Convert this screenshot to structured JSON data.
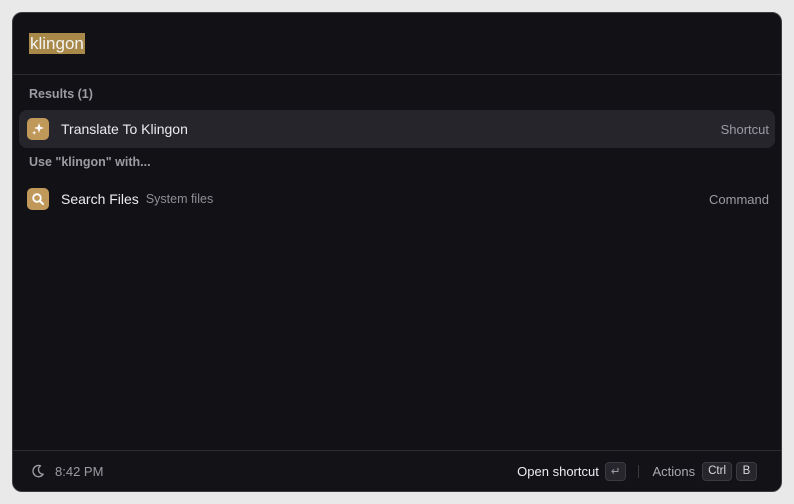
{
  "search": {
    "query": "klingon"
  },
  "sections": {
    "results_title": "Results (1)",
    "fallback_title": "Use \"klingon\" with..."
  },
  "items": [
    {
      "title": "Translate To Klingon",
      "subtitle": "",
      "accessory": "Shortcut",
      "icon": "sparkles-icon",
      "selected": true
    },
    {
      "title": "Search Files",
      "subtitle": "System files",
      "accessory": "Command",
      "icon": "search-icon",
      "selected": false
    }
  ],
  "footer": {
    "time": "8:42 PM",
    "primary_action": "Open shortcut",
    "enter_key": "↵",
    "actions_label": "Actions",
    "key_ctrl": "Ctrl",
    "key_b": "B"
  },
  "colors": {
    "background": "#121216",
    "accent": "#c0985a",
    "selection_highlight": "#a8894a",
    "selected_row": "#25252b"
  }
}
